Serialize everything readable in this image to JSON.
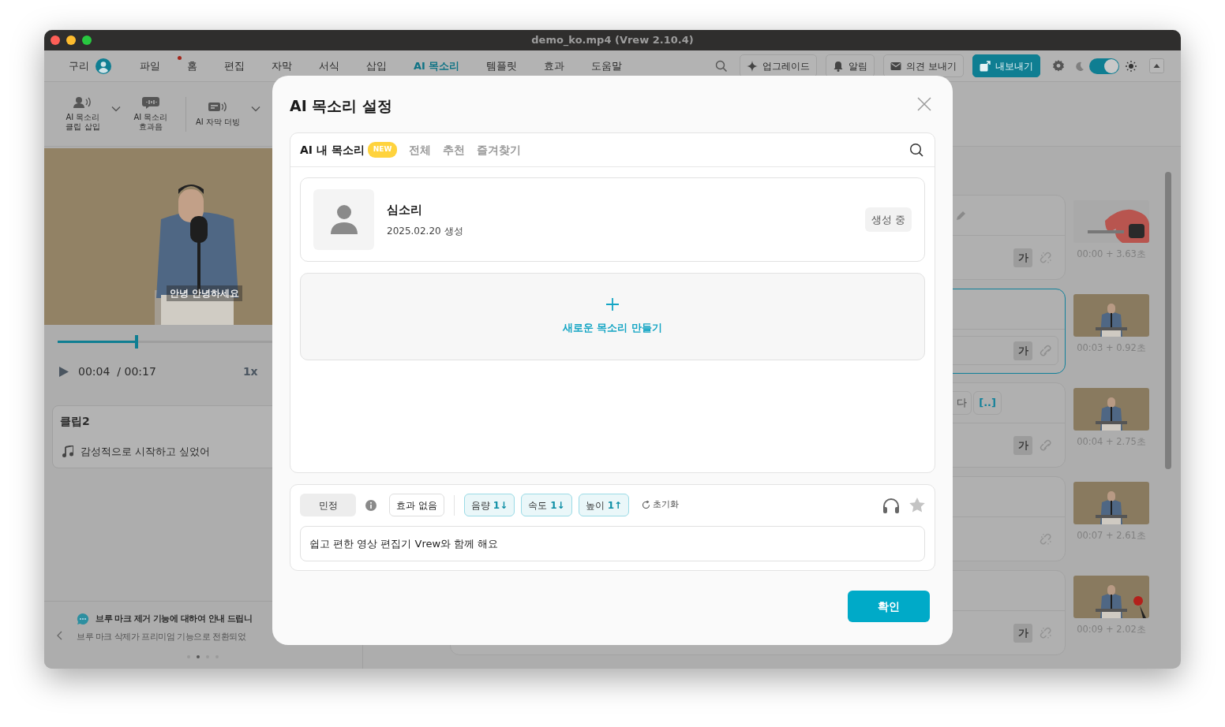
{
  "window": {
    "title": "demo_ko.mp4 (Vrew 2.10.4)"
  },
  "menu_bar": {
    "user": "구리",
    "tabs": [
      {
        "label": "파일",
        "selected": false,
        "badge": false
      },
      {
        "label": "홈",
        "selected": false,
        "badge": true
      },
      {
        "label": "편집",
        "selected": false,
        "badge": false
      },
      {
        "label": "자막",
        "selected": false,
        "badge": false
      },
      {
        "label": "서식",
        "selected": false,
        "badge": false
      },
      {
        "label": "삽입",
        "selected": false,
        "badge": false
      },
      {
        "label": "AI 목소리",
        "selected": true,
        "badge": false
      },
      {
        "label": "템플릿",
        "selected": false,
        "badge": false
      },
      {
        "label": "효과",
        "selected": false,
        "badge": false
      },
      {
        "label": "도움말",
        "selected": false,
        "badge": false
      }
    ],
    "actions": [
      {
        "label": "업그레이드",
        "primary": false
      },
      {
        "label": "알림",
        "primary": false
      },
      {
        "label": "의견 보내기",
        "primary": false
      },
      {
        "label": "내보내기",
        "primary": true
      }
    ],
    "theme_toggle": {
      "on": true
    }
  },
  "toolbar": {
    "items": [
      {
        "label": "AI 목소리\n클립 삽입",
        "dropdown": true
      },
      {
        "label": "AI 목소리\n효과음",
        "dropdown": false
      },
      {
        "label": "AI 자막 더빙",
        "dropdown": true
      }
    ]
  },
  "player": {
    "caption": "안녕 안녕하세요",
    "level": 0.27,
    "current": "00:04",
    "total": "/ 00:17",
    "speed": "1x"
  },
  "clip": {
    "title": "클립2",
    "text": "감성적으로 시작하고 싶었어"
  },
  "notice": {
    "title": "브루 마크 제거 기능에 대하여 안내 드립니",
    "body": "브루 마크 삭제가 프리미엄 기능으로 전환되었",
    "pages": [
      {
        "selected": false
      },
      {
        "selected": true
      },
      {
        "selected": false
      },
      {
        "selected": false
      }
    ]
  },
  "clips": [
    {
      "selected": false,
      "top": [
        {
          "kind": "edit"
        }
      ],
      "style_label": "가",
      "linked": false,
      "time": "00:00 + 3.63초"
    },
    {
      "selected": true,
      "style_label": "가",
      "linked": true,
      "time": "00:03 + 0.92초"
    },
    {
      "selected": false,
      "top": [
        {
          "kind": "word",
          "text": "다"
        },
        {
          "kind": "pause",
          "text": "[..]"
        }
      ],
      "style_label": "가",
      "linked": true,
      "time": "00:04 + 2.75초"
    },
    {
      "selected": false,
      "linked": false,
      "time": "00:07 + 2.61초"
    },
    {
      "selected": false,
      "style_label": "가",
      "linked": false,
      "time": "00:09 + 2.02초"
    }
  ],
  "dialog": {
    "title": "AI 목소리 설정",
    "tabs": [
      {
        "label": "AI 내 목소리",
        "selected": true,
        "badge": "NEW"
      },
      {
        "label": "전체",
        "selected": false
      },
      {
        "label": "추천",
        "selected": false
      },
      {
        "label": "즐겨찾기",
        "selected": false
      }
    ],
    "voices": [
      {
        "name": "심소리",
        "date": "2025.02.20 생성",
        "status": "생성 중"
      }
    ],
    "create_label": "새로운 목소리 만들기",
    "settings": {
      "voice": "민정",
      "effect": "효과 없음",
      "adjustments": [
        {
          "label": "음량",
          "value": "1↓"
        },
        {
          "label": "속도",
          "value": "1↓"
        },
        {
          "label": "높이",
          "value": "1↑"
        }
      ],
      "reset": "초기화",
      "favorite": false,
      "text": "쉽고 편한 영상 편집기 Vrew와 함께 해요"
    },
    "confirm": "확인"
  }
}
